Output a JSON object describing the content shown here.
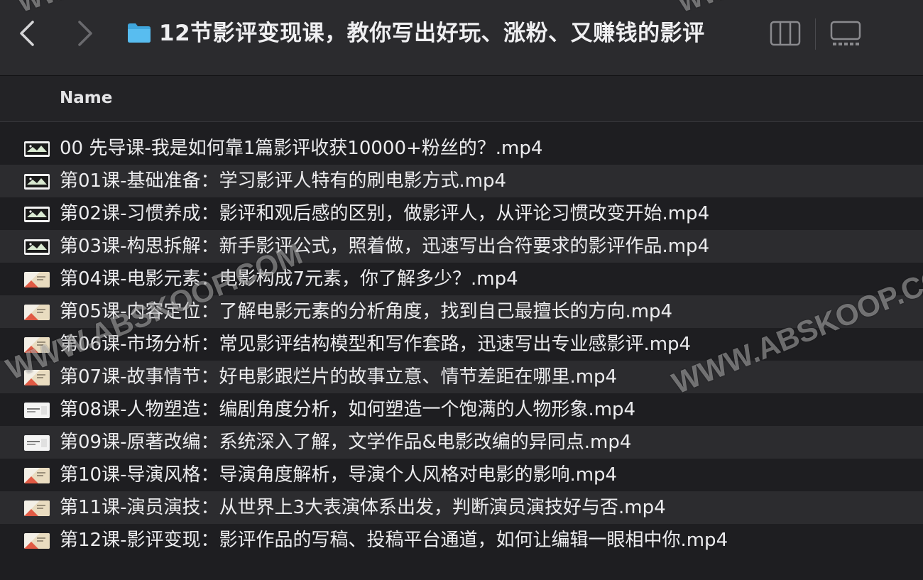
{
  "window": {
    "title": "12节影评变现课，教你写出好玩、涨粉、又赚钱的影评"
  },
  "toolbar": {
    "back_icon": "chevron-left-icon",
    "forward_icon": "chevron-right-icon",
    "folder_icon": "folder-icon",
    "columns_view_icon": "columns-view-icon",
    "gallery_view_icon": "gallery-view-icon"
  },
  "list_header": {
    "name_label": "Name"
  },
  "files": [
    {
      "name": "00 先导课-我是如何靠1篇影评收获10000+粉丝的？.mp4",
      "thumb": "dark"
    },
    {
      "name": "第01课-基础准备：学习影评人特有的刷电影方式.mp4",
      "thumb": "dark"
    },
    {
      "name": "第02课-习惯养成：影评和观后感的区别，做影评人，从评论习惯改变开始.mp4",
      "thumb": "dark"
    },
    {
      "name": "第03课-构思拆解：新手影评公式，照着做，迅速写出合符要求的影评作品.mp4",
      "thumb": "dark"
    },
    {
      "name": "第04课-电影元素：电影构成7元素，你了解多少？.mp4",
      "thumb": "light"
    },
    {
      "name": "第05课-内容定位：了解电影元素的分析角度，找到自己最擅长的方向.mp4",
      "thumb": "light"
    },
    {
      "name": "第06课-市场分析：常见影评结构模型和写作套路，迅速写出专业感影评.mp4",
      "thumb": "light"
    },
    {
      "name": "第07课-故事情节：好电影跟烂片的故事立意、情节差距在哪里.mp4",
      "thumb": "light"
    },
    {
      "name": "第08课-人物塑造：编剧角度分析，如何塑造一个饱满的人物形象.mp4",
      "thumb": "plain"
    },
    {
      "name": "第09课-原著改编：系统深入了解，文学作品&电影改编的异同点.mp4",
      "thumb": "plain"
    },
    {
      "name": "第10课-导演风格：导演角度解析，导演个人风格对电影的影响.mp4",
      "thumb": "light"
    },
    {
      "name": "第11课-演员演技：从世界上3大表演体系出发，判断演员演技好与否.mp4",
      "thumb": "light"
    },
    {
      "name": "第12课-影评变现：影评作品的写稿、投稿平台通道，如何让编辑一眼相中你.mp4",
      "thumb": "light"
    }
  ],
  "watermarks": {
    "text": "WWW.ABSKOOP.COM"
  },
  "colors": {
    "folder": "#4fb3e8",
    "background": "#1e1e21",
    "row_alt": "#2c2c2f"
  }
}
